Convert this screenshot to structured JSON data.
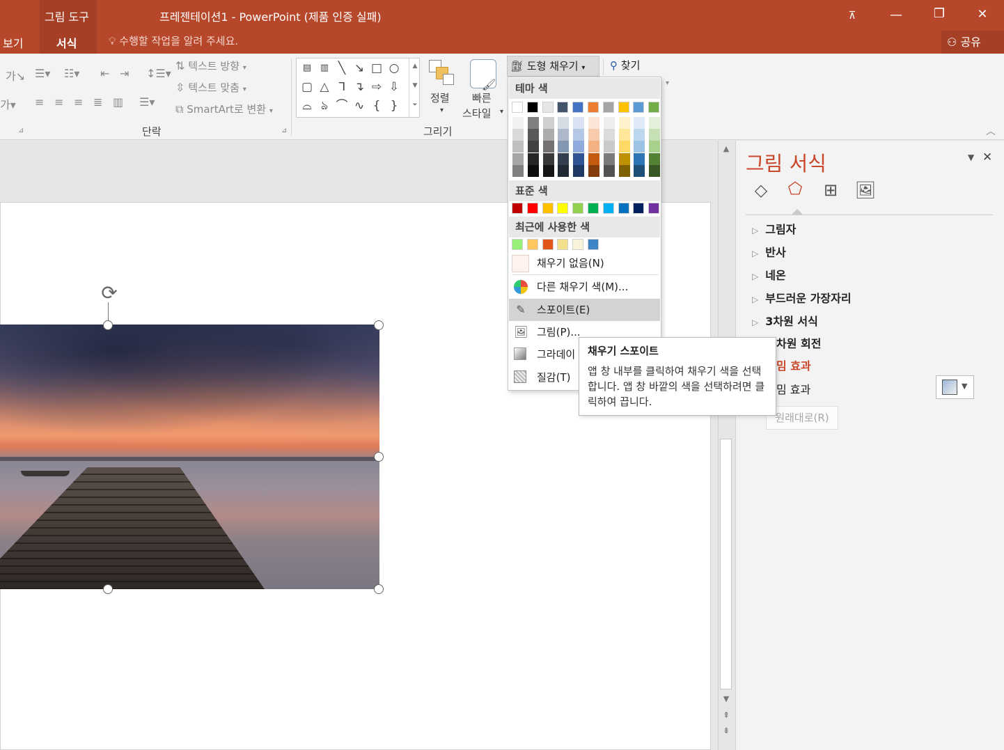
{
  "titlebar": {
    "contextual_tab": "그림 도구",
    "title": "프레젠테이션1 - PowerPoint (제품 인증 실패)",
    "tabs": [
      "보기",
      "서식"
    ],
    "tell_me": "수행할 작업을 알려 주세요.",
    "share": "공유",
    "buttons": {
      "ribbon_display": "⊼",
      "minimize": "—",
      "restore": "❐",
      "close": "✕"
    }
  },
  "ribbon": {
    "paragraph_group_label": "단락",
    "drawing_group_label": "그리기",
    "text_direction": "텍스트 방향",
    "align_text": "텍스트 맞춤",
    "smartart": "SmartArt로 변환",
    "arrange": "정렬",
    "quick_styles": [
      "빠른",
      "스타일"
    ],
    "shape_fill": "도형 채우기",
    "find": "찾기"
  },
  "fill_menu": {
    "theme_header": "테마 색",
    "standard_header": "표준 색",
    "recent_header": "최근에 사용한 색",
    "theme_colors": [
      "#ffffff",
      "#000000",
      "#e7e6e6",
      "#44546a",
      "#4472c4",
      "#ed7d31",
      "#a5a5a5",
      "#ffc000",
      "#5b9bd5",
      "#70ad47"
    ],
    "theme_shades": [
      [
        "#f2f2f2",
        "#d9d9d9",
        "#bfbfbf",
        "#a6a6a6",
        "#808080"
      ],
      [
        "#808080",
        "#595959",
        "#404040",
        "#262626",
        "#0d0d0d"
      ],
      [
        "#d0cece",
        "#aeabab",
        "#757171",
        "#3b3838",
        "#171616"
      ],
      [
        "#d6dce4",
        "#adb9ca",
        "#8497b0",
        "#333f4f",
        "#222a35"
      ],
      [
        "#dae3f3",
        "#b4c7e7",
        "#8faadc",
        "#2f5597",
        "#1f3864"
      ],
      [
        "#fbe5d6",
        "#f8cbad",
        "#f4b183",
        "#c55a11",
        "#843c0c"
      ],
      [
        "#ededed",
        "#dbdbdb",
        "#c9c9c9",
        "#7b7b7b",
        "#525252"
      ],
      [
        "#fff2cc",
        "#ffe699",
        "#ffd966",
        "#bf9000",
        "#7f6000"
      ],
      [
        "#deebf7",
        "#bdd7ee",
        "#9dc3e6",
        "#2e75b6",
        "#1f4e79"
      ],
      [
        "#e2f0d9",
        "#c5e0b4",
        "#a9d18e",
        "#548235",
        "#385723"
      ]
    ],
    "standard_colors": [
      "#c00000",
      "#ff0000",
      "#ffc000",
      "#ffff00",
      "#92d050",
      "#00b050",
      "#00b0f0",
      "#0070c0",
      "#002060",
      "#7030a0"
    ],
    "recent_colors": [
      "#99ee77",
      "#ffc660",
      "#e2561c",
      "#f2e08c",
      "#f8f3da",
      "#3d85c6"
    ],
    "no_fill": "채우기 없음(N)",
    "more_colors": "다른 채우기 색(M)...",
    "eyedropper": "스포이트(E)",
    "picture": "그림(P)...",
    "gradient": "그라데이",
    "texture": "질감(T)"
  },
  "tooltip": {
    "title": "채우기 스포이트",
    "body": "앱 창 내부를 클릭하여 채우기 색을 선택합니다. 앱 창 바깥의 색을 선택하려면 클릭하여 끕니다."
  },
  "format_pane": {
    "title": "그림 서식",
    "sections": [
      "그림자",
      "반사",
      "네온",
      "부드러운 가장자리",
      "3차원 서식",
      "차원 회전",
      "밈 효과",
      "밈 효과"
    ],
    "reset": "원래대로(R)"
  }
}
